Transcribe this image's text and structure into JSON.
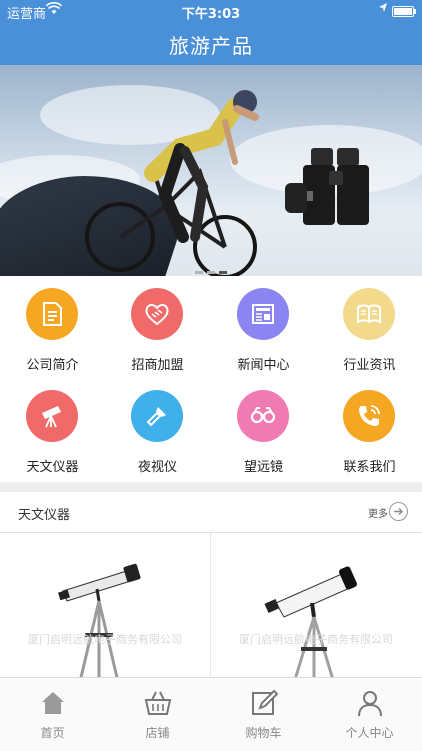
{
  "status_bar": {
    "carrier": "运营商",
    "time": "下午3:03"
  },
  "nav": {
    "title": "旅游产品"
  },
  "banner": {
    "slides": 3,
    "active_slide": 2
  },
  "menu": [
    {
      "label": "公司简介",
      "icon": "document-icon",
      "color": "#f5a623"
    },
    {
      "label": "招商加盟",
      "icon": "handshake-icon",
      "color": "#f06a6a"
    },
    {
      "label": "新闻中心",
      "icon": "newspaper-icon",
      "color": "#8a85f0"
    },
    {
      "label": "行业资讯",
      "icon": "book-icon",
      "color": "#f2d98c"
    },
    {
      "label": "天文仪器",
      "icon": "telescope-icon",
      "color": "#f06a6a"
    },
    {
      "label": "夜视仪",
      "icon": "flashlight-icon",
      "color": "#3fb0ea"
    },
    {
      "label": "望远镜",
      "icon": "binoculars-icon",
      "color": "#f07ab2"
    },
    {
      "label": "联系我们",
      "icon": "phone-icon",
      "color": "#f5a623"
    }
  ],
  "section": {
    "title": "天文仪器",
    "more_label": "更多"
  },
  "products": [
    {
      "watermark": "厦门启明远航电子商务有限公司"
    },
    {
      "watermark": "厦门启明远航电子商务有限公司"
    }
  ],
  "tabbar": [
    {
      "label": "首页",
      "icon": "home-icon"
    },
    {
      "label": "店铺",
      "icon": "basket-icon"
    },
    {
      "label": "购物车",
      "icon": "edit-icon"
    },
    {
      "label": "个人中心",
      "icon": "user-icon"
    }
  ],
  "colors": {
    "primary": "#4a90d9",
    "tab_text": "#888888"
  }
}
